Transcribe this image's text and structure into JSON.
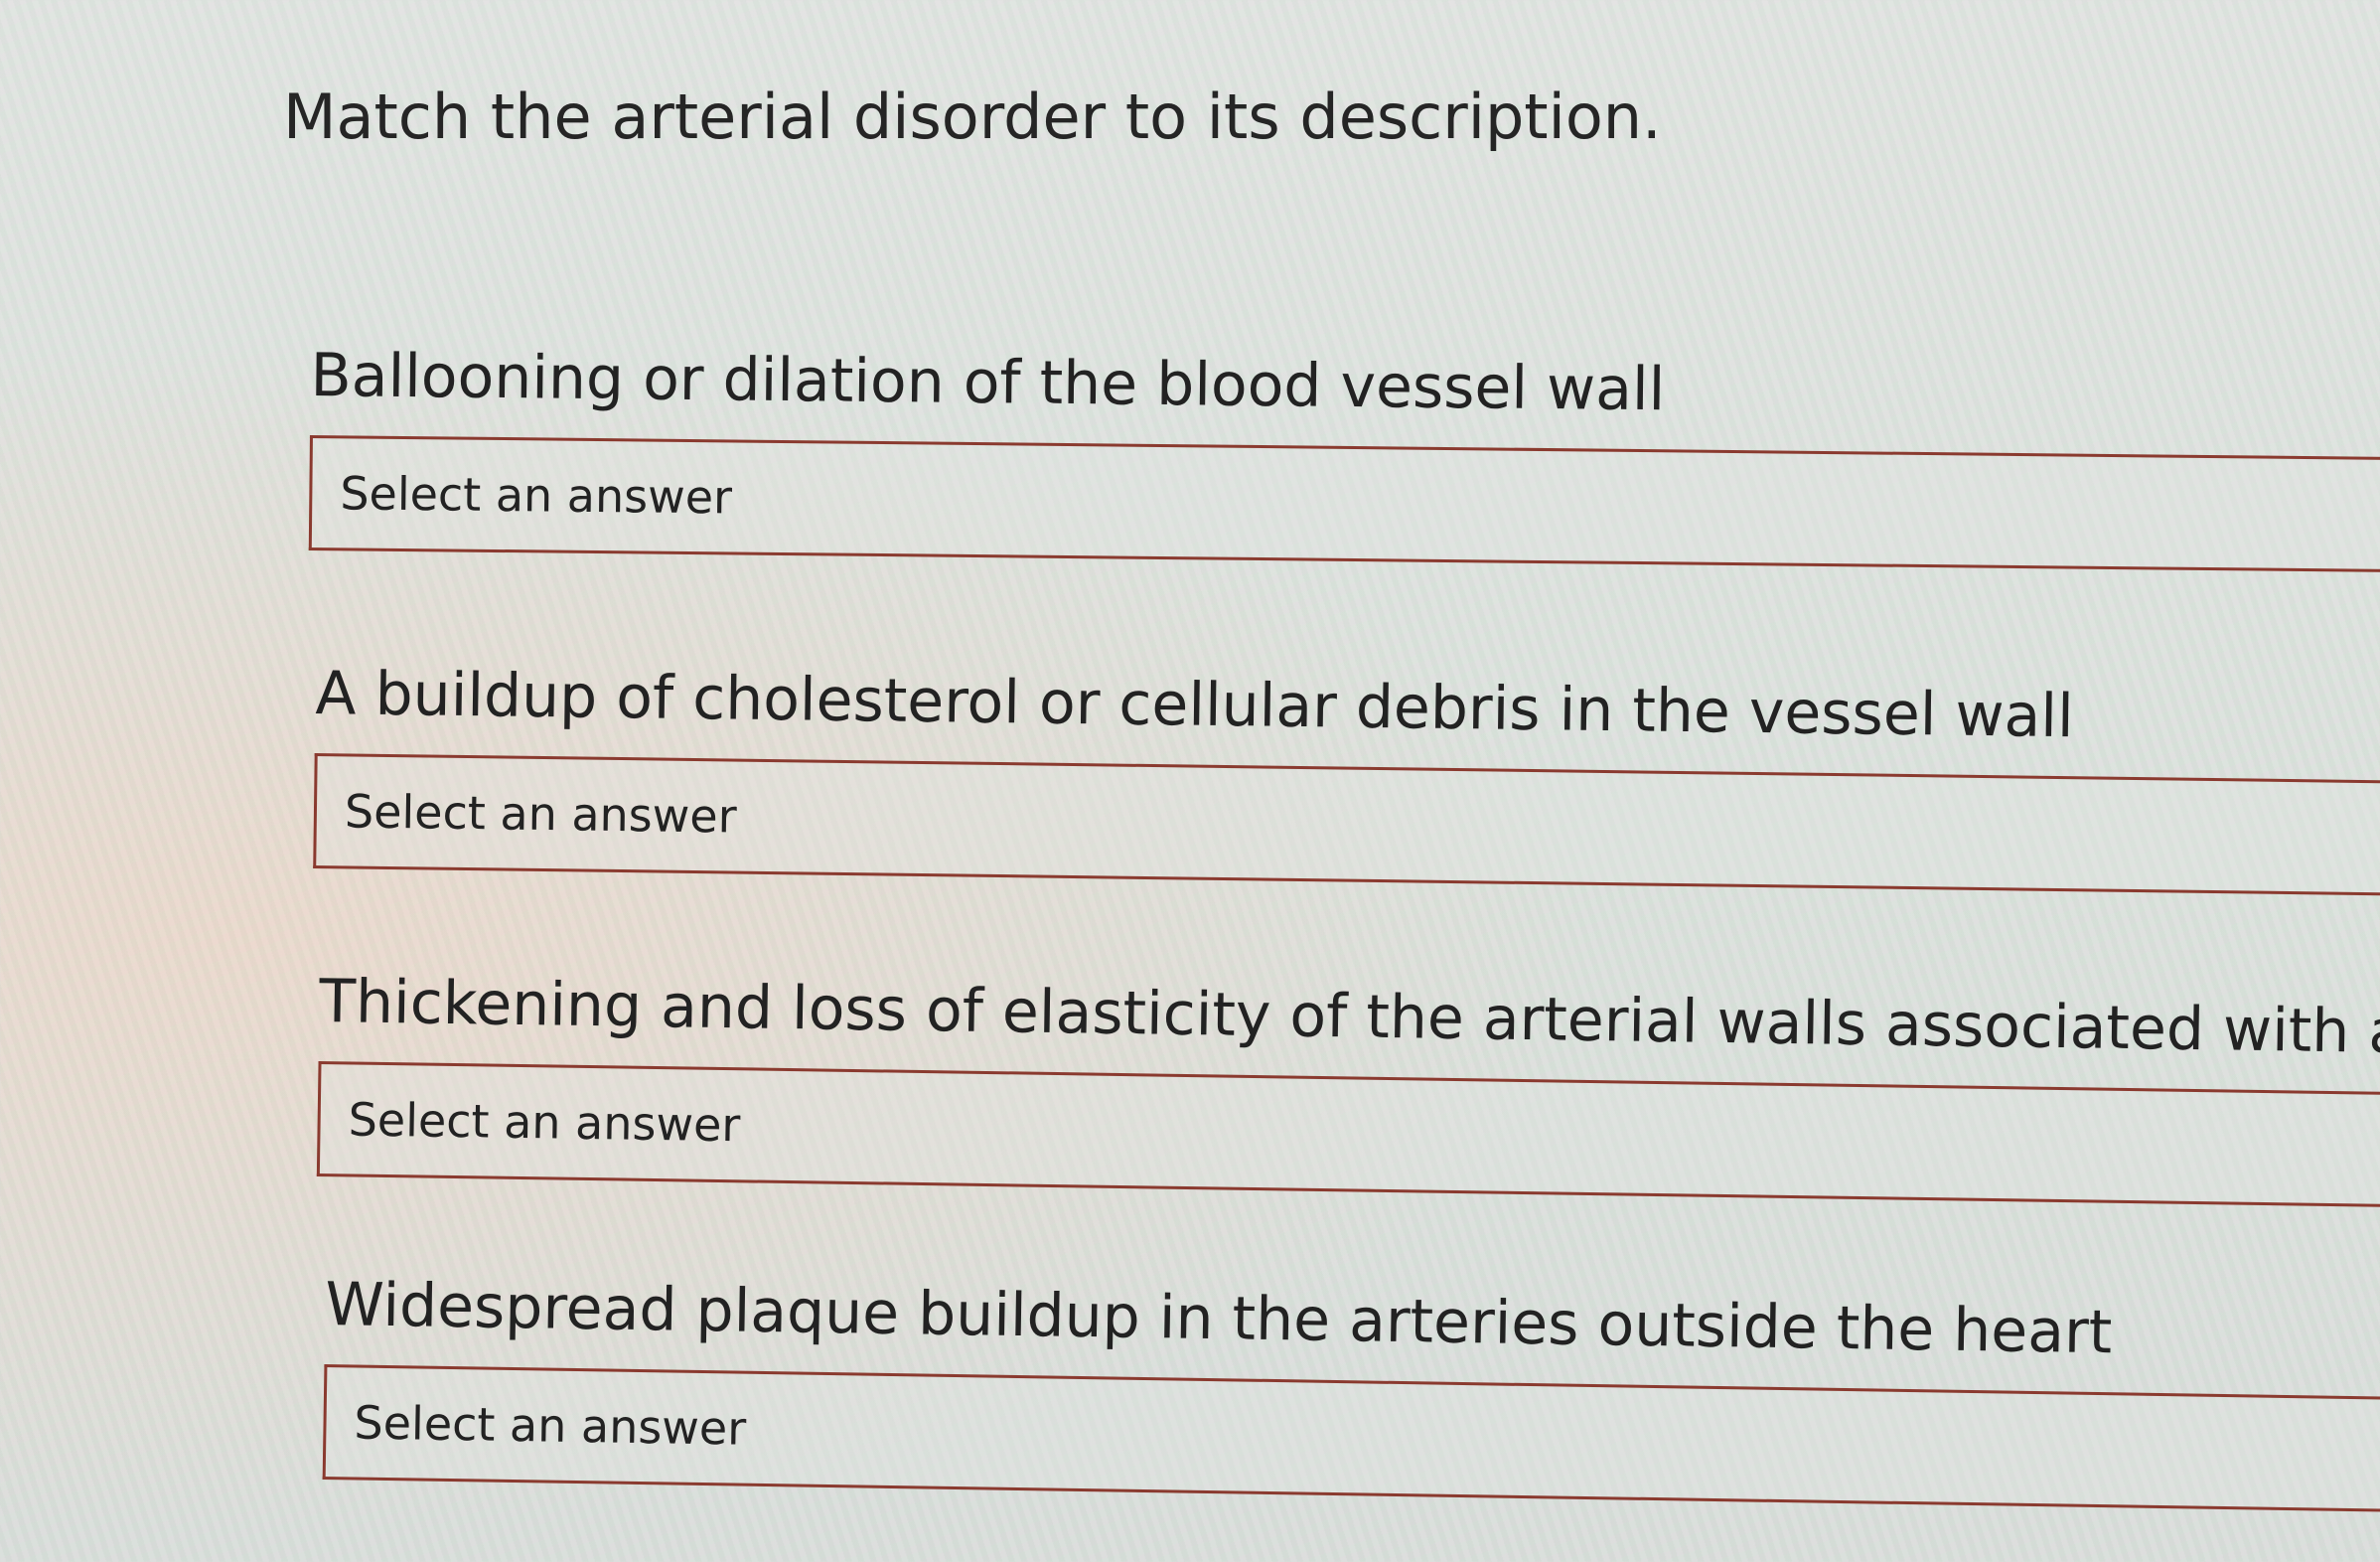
{
  "instruction": "Match the arterial disorder to its description.",
  "questions": [
    {
      "text": "Ballooning or dilation of the blood vessel wall",
      "placeholder": "Select an answer"
    },
    {
      "text": "A buildup of cholesterol or cellular debris in the vessel wall",
      "placeholder": "Select an answer"
    },
    {
      "text": "Thickening and loss of elasticity of the arterial walls associated with age",
      "placeholder": "Select an answer"
    },
    {
      "text": "Widespread plaque buildup in the arteries outside the heart",
      "placeholder": "Select an answer"
    }
  ],
  "colors": {
    "select_border": "#8a3a2f",
    "text": "#222222"
  }
}
